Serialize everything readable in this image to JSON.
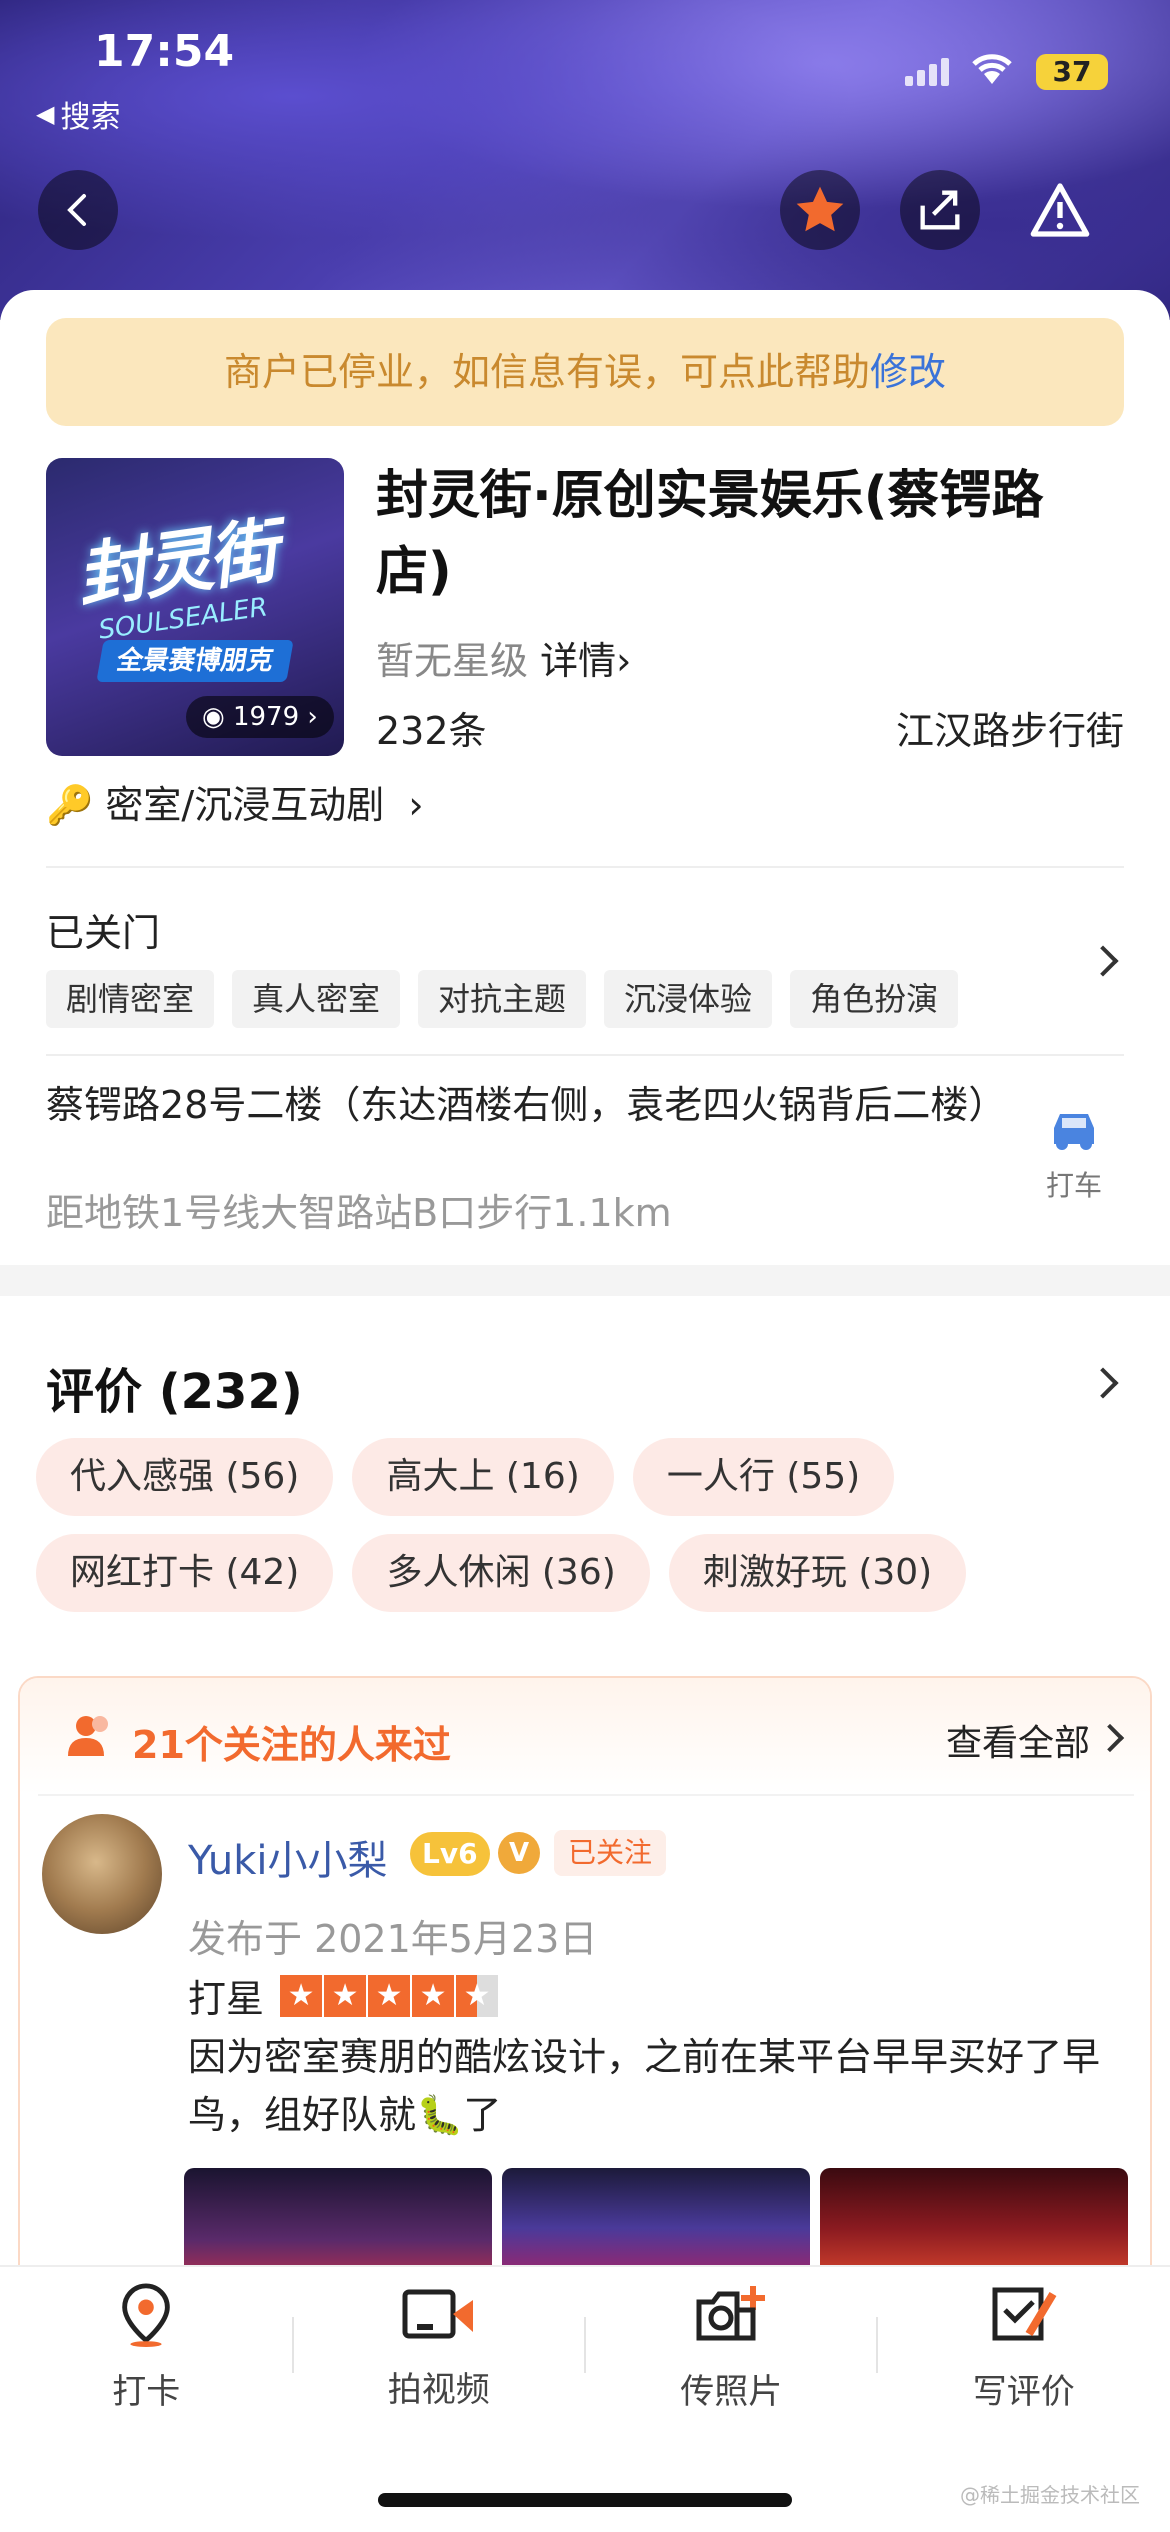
{
  "status": {
    "time": "17:54",
    "back_app": "搜索",
    "battery": "37"
  },
  "notice": {
    "text": "商户已停业，如信息有误，可点此帮助",
    "link": "修改"
  },
  "shop": {
    "name": "封灵街·原创实景娱乐(蔡锷路店)",
    "photo_count": "1979",
    "thumb_title": "封灵街",
    "thumb_subtitle": "SOULSEALER",
    "thumb_tagline": "全景赛博朋克",
    "rating": "暂无星级",
    "details_link": "详情",
    "review_count": "232条",
    "area": "江汉路步行街",
    "category": "密室/沉浸互动剧",
    "hours": "已关门",
    "tags": [
      "剧情密室",
      "真人密室",
      "对抗主题",
      "沉浸体验",
      "角色扮演"
    ],
    "address": "蔡锷路28号二楼（东达酒楼右侧，袁老四火锅背后二楼）",
    "distance": "距地铁1号线大智路站B口步行1.1km",
    "taxi_label": "打车"
  },
  "reviews": {
    "title": "评价 (232)",
    "pills": [
      "代入感强 (56)",
      "高大上 (16)",
      "一人行 (55)",
      "网红打卡 (42)",
      "多人休闲 (36)",
      "刺激好玩 (30)"
    ],
    "follow_title": "21个关注的人来过",
    "view_all": "查看全部",
    "item": {
      "user": "Yuki小小梨",
      "level": "Lv6",
      "vip": "V",
      "followed": "已关注",
      "date": "发布于 2021年5月23日",
      "score_label": "打星",
      "stars": 4.5,
      "text": "因为密室赛朋的酷炫设计，之前在某平台早早买好了早鸟，组好队就🐛了"
    }
  },
  "bottom_tabs": [
    {
      "label": "打卡",
      "icon": "location-pin-icon"
    },
    {
      "label": "拍视频",
      "icon": "video-icon"
    },
    {
      "label": "传照片",
      "icon": "camera-add-icon"
    },
    {
      "label": "写评价",
      "icon": "edit-review-icon"
    }
  ],
  "watermark": "@稀土掘金技术社区",
  "colors": {
    "accent": "#f26a2e",
    "link": "#3a73d9",
    "notice_bg": "#fbe7bd",
    "notice_text": "#c9892e"
  }
}
